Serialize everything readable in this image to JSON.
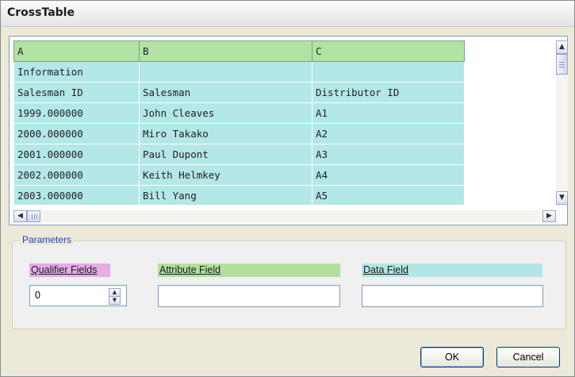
{
  "window": {
    "title": "CrossTable"
  },
  "grid": {
    "columns": [
      "A",
      "B",
      "C"
    ],
    "rows": [
      [
        "Information",
        "",
        ""
      ],
      [
        "Salesman ID",
        "Salesman",
        "Distributor ID"
      ],
      [
        "1999.000000",
        "John Cleaves",
        "A1"
      ],
      [
        "2000.000000",
        "Miro Takako",
        "A2"
      ],
      [
        "2001.000000",
        "Paul Dupont",
        "A3"
      ],
      [
        "2002.000000",
        "Keith Helmkey",
        "A4"
      ],
      [
        "2003.000000",
        "Bill Yang",
        "A5"
      ]
    ]
  },
  "parameters": {
    "legend": "Parameters",
    "qualifier_label": "Qualifier Fields",
    "qualifier_value": "0",
    "attribute_label": "Attribute Field",
    "attribute_value": "",
    "data_label": "Data Field",
    "data_value": ""
  },
  "buttons": {
    "ok": "OK",
    "cancel": "Cancel"
  },
  "colors": {
    "header_bg": "#b2e3a2",
    "cell_bg": "#b4e7e7",
    "qualifier_bg": "#e6ace6",
    "attribute_bg": "#b2e0a0",
    "data_bg": "#b4e5e5",
    "legend_text": "#1f45c8"
  },
  "icons": {
    "scroll_up": "arrow-up-icon",
    "scroll_down": "arrow-down-icon",
    "scroll_left": "arrow-left-icon",
    "scroll_right": "arrow-right-icon"
  }
}
